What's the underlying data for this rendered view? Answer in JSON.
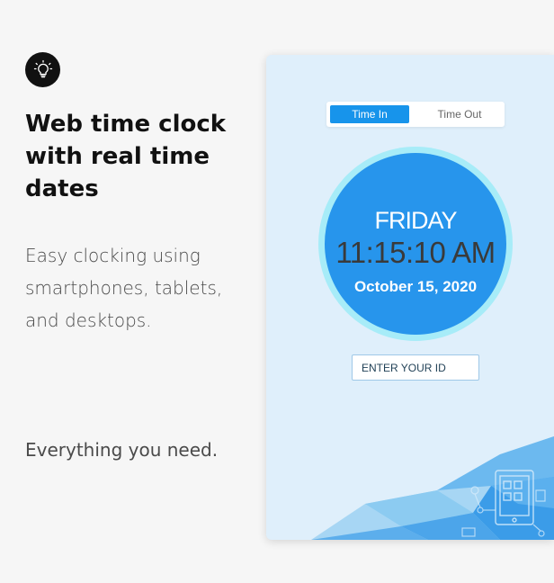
{
  "promo": {
    "icon": "lightbulb-icon",
    "headline": "Web time clock with real time dates",
    "subtext": "Easy clocking using smartphones, tablets, and desktops.",
    "tagline": "Everything you need."
  },
  "clock_app": {
    "tabs": [
      {
        "label": "Time In",
        "active": true
      },
      {
        "label": "Time Out",
        "active": false
      }
    ],
    "day": "FRIDAY",
    "time": "11:15:10 AM",
    "date": "October 15, 2020",
    "id_input": {
      "placeholder": "ENTER YOUR ID",
      "value": ""
    },
    "decoration_icons": [
      "tablet-icon",
      "network-icon"
    ]
  },
  "colors": {
    "accent": "#1794eb",
    "clock_face": "#2795ec",
    "clock_ring": "#a7ecf8",
    "panel_bg": "#dfeffb"
  }
}
